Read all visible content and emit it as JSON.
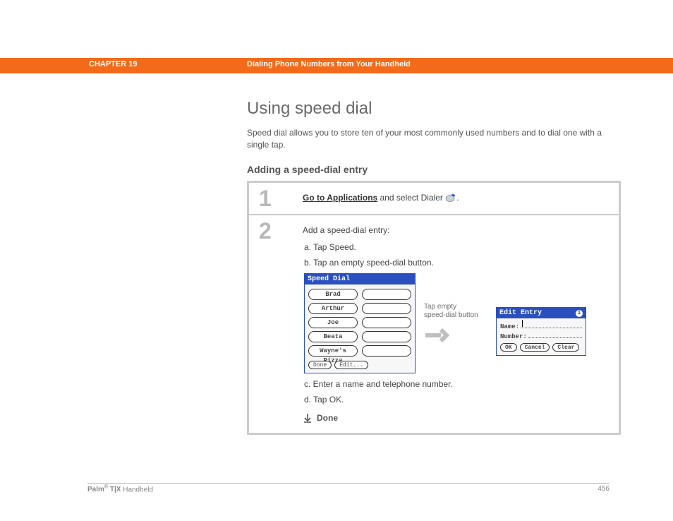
{
  "header": {
    "chapter": "CHAPTER 19",
    "title": "Dialing Phone Numbers from Your Handheld"
  },
  "page": {
    "title": "Using speed dial",
    "intro": "Speed dial allows you to store ten of your most commonly used numbers and to dial one with a single tap.",
    "subtitle": "Adding a speed-dial entry"
  },
  "step1": {
    "num": "1",
    "link": "Go to Applications",
    "rest": " and select Dialer ",
    "period": "."
  },
  "step2": {
    "num": "2",
    "lead": "Add a speed-dial entry:",
    "a": "a.  Tap Speed.",
    "b": "b.  Tap an empty speed-dial button.",
    "c": "c.  Enter a name and telephone number.",
    "d": "d.  Tap OK.",
    "done": "Done"
  },
  "speedDial": {
    "title": "Speed Dial",
    "entries": [
      "Brad",
      "Arthur",
      "Joe",
      "Beata",
      "Wayne's Pizza"
    ],
    "doneBtn": "Done",
    "editBtn": "Edit..."
  },
  "callout": {
    "l1": "Tap empty",
    "l2": "speed-dial button"
  },
  "editEntry": {
    "title": "Edit Entry",
    "nameLbl": "Name:",
    "numberLbl": "Number:",
    "ok": "OK",
    "cancel": "Cancel",
    "clear": "Clear"
  },
  "footer": {
    "brand1": "Palm",
    "reg": "®",
    "brand2": " T|X",
    "brand3": " Handheld",
    "page": "456"
  }
}
